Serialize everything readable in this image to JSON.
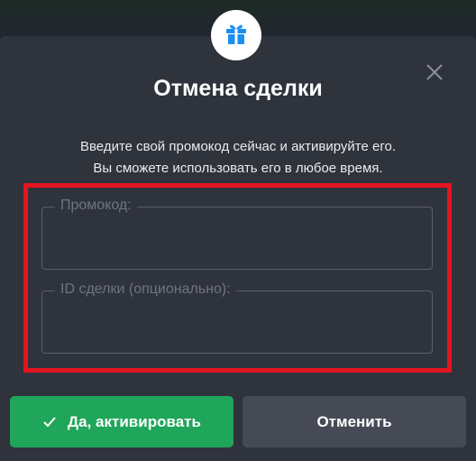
{
  "modal": {
    "title": "Отмена сделки",
    "description_line1": "Введите свой промокод сейчас и активируйте его.",
    "description_line2": "Вы сможете использовать его в любое время.",
    "icon": "gift-icon",
    "close_icon": "close-icon"
  },
  "form": {
    "promo_label": "Промокод:",
    "promo_value": "",
    "deal_id_label": "ID сделки (опционально):",
    "deal_id_value": ""
  },
  "buttons": {
    "activate_label": "Да, активировать",
    "activate_icon": "check-icon",
    "cancel_label": "Отменить"
  },
  "colors": {
    "modal_bg": "#2f333c",
    "accent_green": "#1fa65a",
    "secondary_button": "#454a54",
    "highlight_red": "#e3141e",
    "gift_blue": "#1f8ef1"
  }
}
